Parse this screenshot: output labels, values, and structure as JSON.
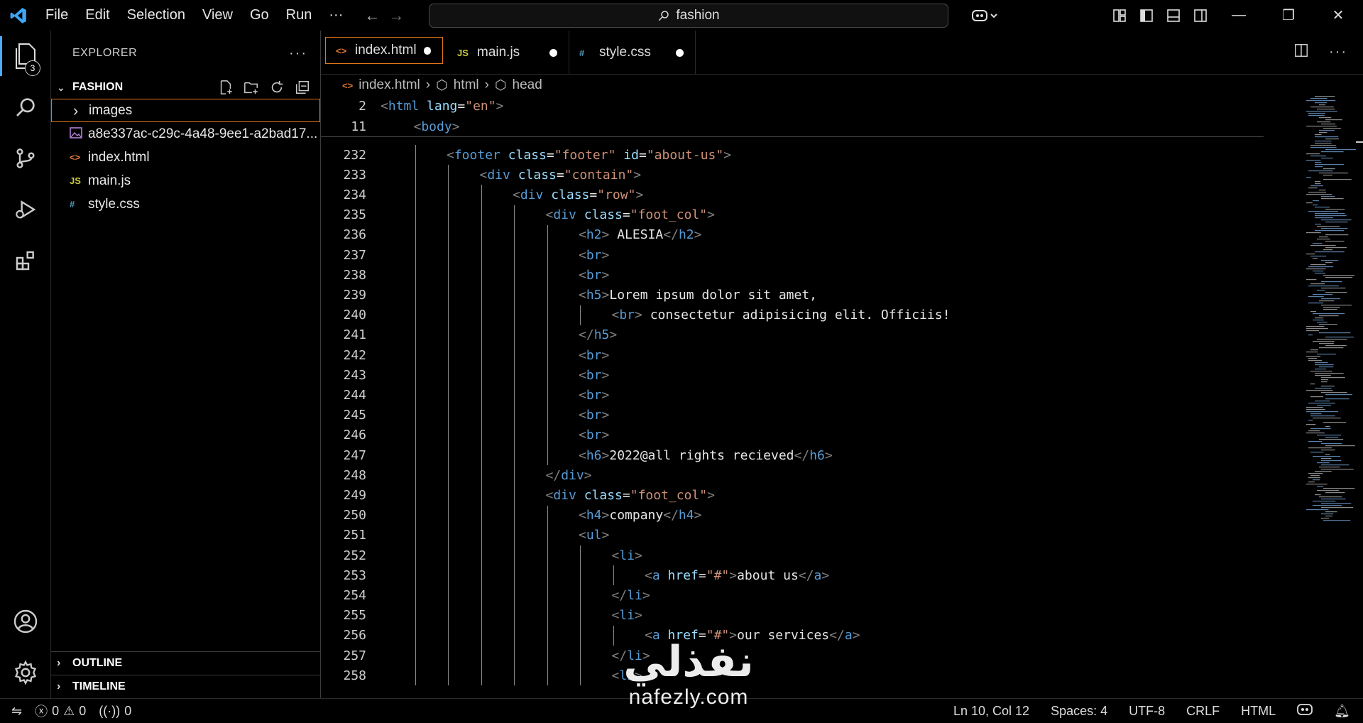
{
  "titlebar": {
    "menu": [
      "File",
      "Edit",
      "Selection",
      "View",
      "Go",
      "Run",
      "···"
    ],
    "search": "fashion"
  },
  "activity": {
    "explorer_badge": "3"
  },
  "sidebar": {
    "title": "EXPLORER",
    "folder": "FASHION",
    "files": [
      {
        "name": "images",
        "icon": "chevron-right-icon",
        "glyph": "›"
      },
      {
        "name": "a8e337ac-c29c-4a48-9ee1-a2bad17...",
        "icon": "image-file-icon",
        "glyph": ""
      },
      {
        "name": "index.html",
        "icon": "html-file-icon",
        "glyph": "<>"
      },
      {
        "name": "main.js",
        "icon": "js-file-icon",
        "glyph": "JS"
      },
      {
        "name": "style.css",
        "icon": "css-file-icon",
        "glyph": "#"
      }
    ],
    "outline": "OUTLINE",
    "timeline": "TIMELINE"
  },
  "tabs": [
    {
      "label": "index.html",
      "glyph": "<>",
      "active": true
    },
    {
      "label": "main.js",
      "glyph": "JS",
      "active": false
    },
    {
      "label": "style.css",
      "glyph": "#",
      "active": false
    }
  ],
  "breadcrumbs": [
    "index.html",
    "html",
    "head"
  ],
  "sticky": [
    {
      "n": "2",
      "code": "<html lang=\"en\">"
    },
    {
      "n": "11",
      "code": "<body>"
    }
  ],
  "lines": [
    {
      "n": "232",
      "indent": 2,
      "code": "<footer class=\"footer\" id=\"about-us\">"
    },
    {
      "n": "233",
      "indent": 3,
      "code": "<div class=\"contain\">"
    },
    {
      "n": "234",
      "indent": 4,
      "code": "<div class=\"row\">"
    },
    {
      "n": "235",
      "indent": 5,
      "code": "<div class=\"foot_col\">"
    },
    {
      "n": "236",
      "indent": 6,
      "code": "<h2> ALESIA</h2>"
    },
    {
      "n": "237",
      "indent": 6,
      "code": "<br>"
    },
    {
      "n": "238",
      "indent": 6,
      "code": "<br>"
    },
    {
      "n": "239",
      "indent": 6,
      "code": "<h5>Lorem ipsum dolor sit amet,"
    },
    {
      "n": "240",
      "indent": 7,
      "code": "<br> consectetur adipisicing elit. Officiis!"
    },
    {
      "n": "241",
      "indent": 6,
      "code": "</h5>"
    },
    {
      "n": "242",
      "indent": 6,
      "code": "<br>"
    },
    {
      "n": "243",
      "indent": 6,
      "code": "<br>"
    },
    {
      "n": "244",
      "indent": 6,
      "code": "<br>"
    },
    {
      "n": "245",
      "indent": 6,
      "code": "<br>"
    },
    {
      "n": "246",
      "indent": 6,
      "code": "<br>"
    },
    {
      "n": "247",
      "indent": 6,
      "code": "<h6>2022@all rights recieved</h6>"
    },
    {
      "n": "248",
      "indent": 5,
      "code": "</div>"
    },
    {
      "n": "249",
      "indent": 5,
      "code": "<div class=\"foot_col\">"
    },
    {
      "n": "250",
      "indent": 6,
      "code": "<h4>company</h4>"
    },
    {
      "n": "251",
      "indent": 6,
      "code": "<ul>"
    },
    {
      "n": "252",
      "indent": 7,
      "code": "<li>"
    },
    {
      "n": "253",
      "indent": 8,
      "code": "<a href=\"#\">about us</a>"
    },
    {
      "n": "254",
      "indent": 7,
      "code": "</li>"
    },
    {
      "n": "255",
      "indent": 7,
      "code": "<li>"
    },
    {
      "n": "256",
      "indent": 8,
      "code": "<a href=\"#\">our services</a>"
    },
    {
      "n": "257",
      "indent": 7,
      "code": "</li>"
    },
    {
      "n": "258",
      "indent": 7,
      "code": "<li>"
    }
  ],
  "status": {
    "errors": "0",
    "warnings": "0",
    "ports": "0",
    "position": "Ln 10, Col 12",
    "spaces": "Spaces: 4",
    "encoding": "UTF-8",
    "eol": "CRLF",
    "language": "HTML"
  },
  "watermark": {
    "arabic": "نفذلي",
    "latin": "nafezly.com"
  }
}
